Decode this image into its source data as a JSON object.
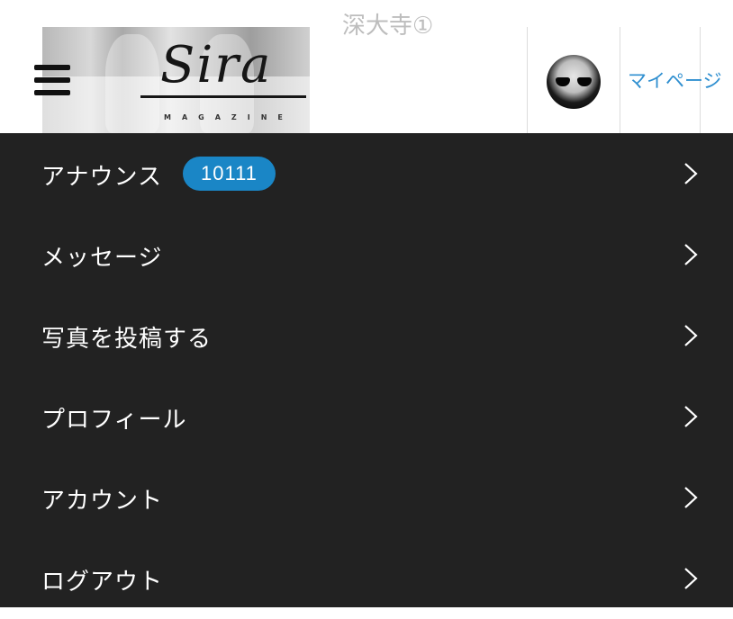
{
  "header": {
    "logo": {
      "script_text": "Sira",
      "subtitle": "MAGAZINE"
    },
    "partial_title": "深大寺①",
    "mypage_label": "マイページ"
  },
  "menu": {
    "items": [
      {
        "label": "アナウンス",
        "badge": "10111"
      },
      {
        "label": "メッセージ"
      },
      {
        "label": "写真を投稿する"
      },
      {
        "label": "プロフィール"
      },
      {
        "label": "アカウント"
      },
      {
        "label": "ログアウト"
      }
    ]
  },
  "icons": {
    "menu_toggle": "hamburger-icon",
    "menu_arrow": "chevron-right-icon"
  },
  "colors": {
    "menu_background": "#222222",
    "badge_background": "#1a86c6",
    "link_blue": "#2f8fd0",
    "menu_text": "#ffffff"
  }
}
